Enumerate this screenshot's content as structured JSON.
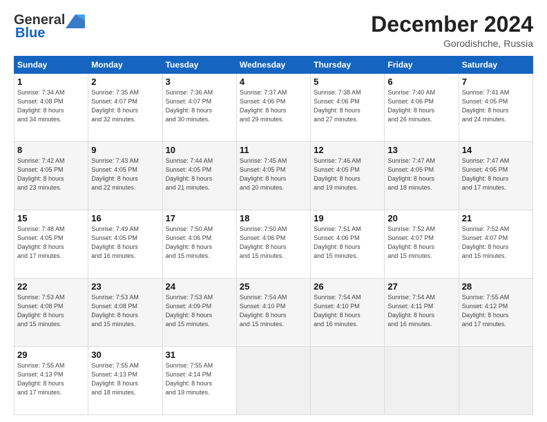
{
  "header": {
    "logo_general": "General",
    "logo_blue": "Blue",
    "month_title": "December 2024",
    "location": "Gorodishche, Russia"
  },
  "days_of_week": [
    "Sunday",
    "Monday",
    "Tuesday",
    "Wednesday",
    "Thursday",
    "Friday",
    "Saturday"
  ],
  "weeks": [
    [
      {
        "day": "1",
        "info": "Sunrise: 7:34 AM\nSunset: 4:08 PM\nDaylight: 8 hours\nand 34 minutes."
      },
      {
        "day": "2",
        "info": "Sunrise: 7:35 AM\nSunset: 4:07 PM\nDaylight: 8 hours\nand 32 minutes."
      },
      {
        "day": "3",
        "info": "Sunrise: 7:36 AM\nSunset: 4:07 PM\nDaylight: 8 hours\nand 30 minutes."
      },
      {
        "day": "4",
        "info": "Sunrise: 7:37 AM\nSunset: 4:06 PM\nDaylight: 8 hours\nand 29 minutes."
      },
      {
        "day": "5",
        "info": "Sunrise: 7:38 AM\nSunset: 4:06 PM\nDaylight: 8 hours\nand 27 minutes."
      },
      {
        "day": "6",
        "info": "Sunrise: 7:40 AM\nSunset: 4:06 PM\nDaylight: 8 hours\nand 26 minutes."
      },
      {
        "day": "7",
        "info": "Sunrise: 7:41 AM\nSunset: 4:05 PM\nDaylight: 8 hours\nand 24 minutes."
      }
    ],
    [
      {
        "day": "8",
        "info": "Sunrise: 7:42 AM\nSunset: 4:05 PM\nDaylight: 8 hours\nand 23 minutes."
      },
      {
        "day": "9",
        "info": "Sunrise: 7:43 AM\nSunset: 4:05 PM\nDaylight: 8 hours\nand 22 minutes."
      },
      {
        "day": "10",
        "info": "Sunrise: 7:44 AM\nSunset: 4:05 PM\nDaylight: 8 hours\nand 21 minutes."
      },
      {
        "day": "11",
        "info": "Sunrise: 7:45 AM\nSunset: 4:05 PM\nDaylight: 8 hours\nand 20 minutes."
      },
      {
        "day": "12",
        "info": "Sunrise: 7:46 AM\nSunset: 4:05 PM\nDaylight: 8 hours\nand 19 minutes."
      },
      {
        "day": "13",
        "info": "Sunrise: 7:47 AM\nSunset: 4:05 PM\nDaylight: 8 hours\nand 18 minutes."
      },
      {
        "day": "14",
        "info": "Sunrise: 7:47 AM\nSunset: 4:05 PM\nDaylight: 8 hours\nand 17 minutes."
      }
    ],
    [
      {
        "day": "15",
        "info": "Sunrise: 7:48 AM\nSunset: 4:05 PM\nDaylight: 8 hours\nand 17 minutes."
      },
      {
        "day": "16",
        "info": "Sunrise: 7:49 AM\nSunset: 4:05 PM\nDaylight: 8 hours\nand 16 minutes."
      },
      {
        "day": "17",
        "info": "Sunrise: 7:50 AM\nSunset: 4:06 PM\nDaylight: 8 hours\nand 15 minutes."
      },
      {
        "day": "18",
        "info": "Sunrise: 7:50 AM\nSunset: 4:06 PM\nDaylight: 8 hours\nand 15 minutes."
      },
      {
        "day": "19",
        "info": "Sunrise: 7:51 AM\nSunset: 4:06 PM\nDaylight: 8 hours\nand 15 minutes."
      },
      {
        "day": "20",
        "info": "Sunrise: 7:52 AM\nSunset: 4:07 PM\nDaylight: 8 hours\nand 15 minutes."
      },
      {
        "day": "21",
        "info": "Sunrise: 7:52 AM\nSunset: 4:07 PM\nDaylight: 8 hours\nand 15 minutes."
      }
    ],
    [
      {
        "day": "22",
        "info": "Sunrise: 7:53 AM\nSunset: 4:08 PM\nDaylight: 8 hours\nand 15 minutes."
      },
      {
        "day": "23",
        "info": "Sunrise: 7:53 AM\nSunset: 4:08 PM\nDaylight: 8 hours\nand 15 minutes."
      },
      {
        "day": "24",
        "info": "Sunrise: 7:53 AM\nSunset: 4:09 PM\nDaylight: 8 hours\nand 15 minutes."
      },
      {
        "day": "25",
        "info": "Sunrise: 7:54 AM\nSunset: 4:10 PM\nDaylight: 8 hours\nand 15 minutes."
      },
      {
        "day": "26",
        "info": "Sunrise: 7:54 AM\nSunset: 4:10 PM\nDaylight: 8 hours\nand 16 minutes."
      },
      {
        "day": "27",
        "info": "Sunrise: 7:54 AM\nSunset: 4:11 PM\nDaylight: 8 hours\nand 16 minutes."
      },
      {
        "day": "28",
        "info": "Sunrise: 7:55 AM\nSunset: 4:12 PM\nDaylight: 8 hours\nand 17 minutes."
      }
    ],
    [
      {
        "day": "29",
        "info": "Sunrise: 7:55 AM\nSunset: 4:13 PM\nDaylight: 8 hours\nand 17 minutes."
      },
      {
        "day": "30",
        "info": "Sunrise: 7:55 AM\nSunset: 4:13 PM\nDaylight: 8 hours\nand 18 minutes."
      },
      {
        "day": "31",
        "info": "Sunrise: 7:55 AM\nSunset: 4:14 PM\nDaylight: 8 hours\nand 19 minutes."
      },
      null,
      null,
      null,
      null
    ]
  ]
}
